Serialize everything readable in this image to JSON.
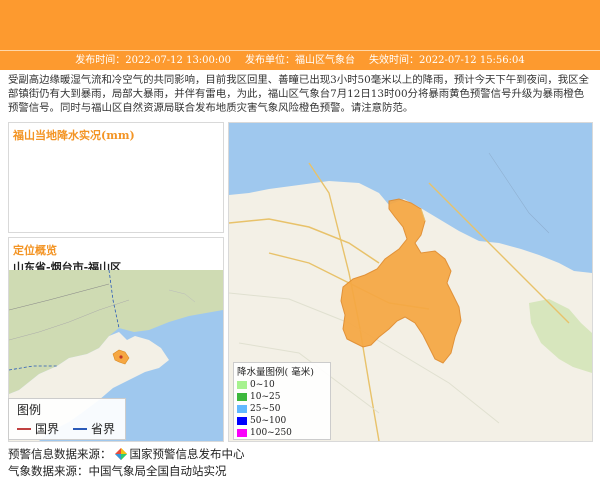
{
  "header": {
    "publish_time": "发布时间：2022-07-12 13:00:00",
    "publisher": "发布单位：福山区气象台",
    "expire_time": "失效时间：2022-07-12 15:56:04"
  },
  "description": "受副高边缘暖湿气流和冷空气的共同影响，目前我区回里、善疃已出现3小时50毫米以上的降雨，预计今天下午到夜间，我区全部镇街仍有大到暴雨，局部大暴雨，并伴有雷电，为此，福山区气象台7月12日13时00分将暴雨黄色预警信号升级为暴雨橙色预警信号。同时与福山区自然资源局联合发布地质灾害气象风险橙色预警。请注意防范。",
  "rainfall_panel": {
    "title": "福山当地降水实况(mm)"
  },
  "location_panel": {
    "title": "定位概览",
    "location": "山东省-烟台市-福山区",
    "legend": {
      "title": "图例",
      "items": [
        {
          "label": "国界",
          "color": "#c04040"
        },
        {
          "label": "省界",
          "color": "#2a5ab8"
        }
      ]
    }
  },
  "rain_legend": {
    "title": "降水量图例( 毫米)",
    "items": [
      {
        "label": "0~10",
        "color": "#a6f28f"
      },
      {
        "label": "10~25",
        "color": "#3db83d"
      },
      {
        "label": "25~50",
        "color": "#61b8ff"
      },
      {
        "label": "50~100",
        "color": "#0000fe"
      },
      {
        "label": "100~250",
        "color": "#fa00fa"
      }
    ]
  },
  "source": {
    "label": "预警信息数据来源：",
    "name": "国家预警信息发布中心"
  },
  "footer_partial": "气象数据来源：中国气象局全国自动站实况"
}
